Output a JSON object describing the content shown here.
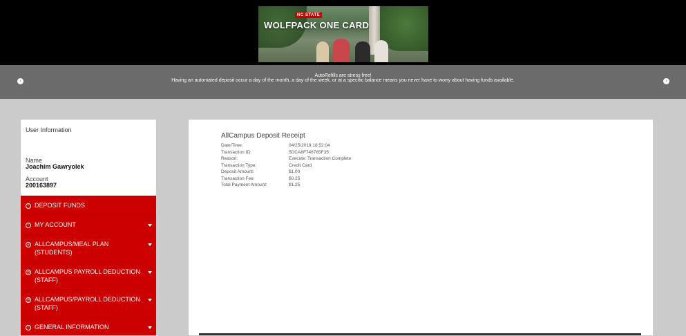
{
  "banner": {
    "badge": "NC STATE",
    "title": "WOLFPACK ONE CARD"
  },
  "carousel": {
    "title": "AutoRefills are stress free!",
    "description": "Having an automated deposit occur a day of the month, a day of the week, or at a specific balance means you never have to worry about having funds available.",
    "prev_icon": "chevron-left-icon",
    "next_icon": "chevron-right-icon"
  },
  "user": {
    "heading": "User Information",
    "name_label": "Name",
    "name": "Joachim Gawryolek",
    "account_label": "Account",
    "account": "200163897"
  },
  "menu": {
    "items": [
      {
        "label": "DEPOSIT FUNDS",
        "line2": "",
        "has_caret": false
      },
      {
        "label": "MY ACCOUNT",
        "line2": "",
        "has_caret": true
      },
      {
        "label": "ALLCAMPUS/MEAL PLAN",
        "line2": "(STUDENTS)",
        "has_caret": true
      },
      {
        "label": "ALLCAMPUS PAYROLL DEDUCTION",
        "line2": "(STAFF)",
        "has_caret": true
      },
      {
        "label": "ALLCAMPUS/PAYROLL DEDUCTION",
        "line2": "(STAFF)",
        "has_caret": true
      },
      {
        "label": "GENERAL INFORMATION",
        "line2": "",
        "has_caret": true
      }
    ]
  },
  "receipt": {
    "title": "AllCampus Deposit Receipt",
    "rows": [
      {
        "key": "Date/Time:",
        "value": "04/25/2019 18:52:04"
      },
      {
        "key": "Transaction ID:",
        "value": "5DCA8F748785F35"
      },
      {
        "key": "Reason:",
        "value": "Execute: Transaction Complete"
      },
      {
        "key": "Transaction Type:",
        "value": "Credit Card"
      },
      {
        "key": "Deposit Amount:",
        "value": "$1.00"
      },
      {
        "key": "Transaction Fee:",
        "value": "$0.25"
      },
      {
        "key": "Total Payment Amount:",
        "value": "$1.25"
      }
    ]
  },
  "colors": {
    "brand_red": "#cc0000",
    "carousel_gray": "#6b6b6b",
    "page_bg": "#cbcbcb"
  }
}
